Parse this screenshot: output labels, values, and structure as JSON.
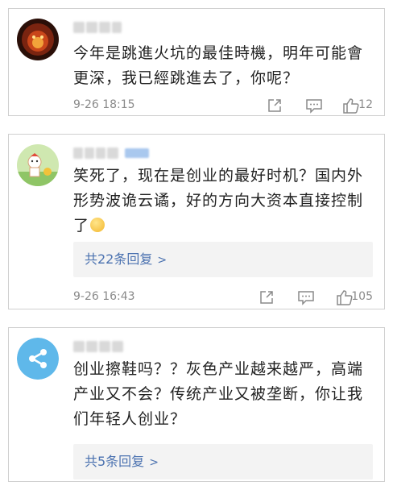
{
  "comments": [
    {
      "text": "今年是跳進火坑的最佳時機，明年可能會更深，我已經跳進去了，你呢？",
      "time": "9-26 18:15",
      "likes": "12"
    },
    {
      "text": "笑死了，现在是创业的最好时机？国内外形势波诡云谲，好的方向大资本直接控制了",
      "time": "9-26 16:43",
      "likes": "105",
      "replies": "共22条回复"
    },
    {
      "text": "创业擦鞋吗？？灰色产业越来越严，高端产业又不会？传统产业又被垄断，你让我们年轻人创业？",
      "replies": "共5条回复"
    }
  ],
  "icons": {
    "share": "share-icon",
    "comment": "comment-icon",
    "like": "thumbs-up-icon",
    "chevron": "chevron-right-icon"
  },
  "colors": {
    "link": "#4b72b0",
    "meta": "#8a8a8a",
    "reply_bg": "#f3f3f3"
  }
}
